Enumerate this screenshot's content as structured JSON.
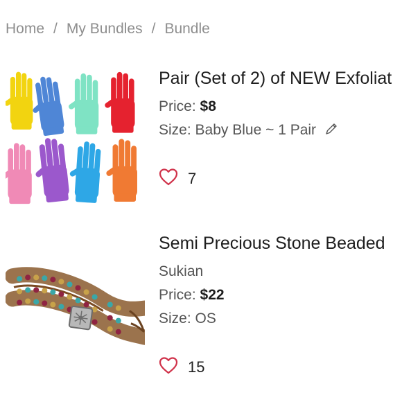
{
  "breadcrumb": {
    "home": "Home",
    "separator": "/",
    "my_bundles": "My Bundles",
    "current": "Bundle"
  },
  "items": [
    {
      "title": "Pair (Set of 2) of NEW Exfoliat",
      "price_label": "Price:",
      "price": "$8",
      "size_label": "Size:",
      "size": "Baby Blue ~ 1 Pair",
      "likes": "7"
    },
    {
      "title": "Semi Precious Stone Beaded",
      "brand": "Sukian",
      "price_label": "Price:",
      "price": "$22",
      "size_label": "Size:",
      "size": "OS",
      "likes": "15"
    }
  ],
  "colors": {
    "accent_heart": "#d0324a",
    "muted_text": "#8e8e8e"
  },
  "icons": {
    "like": "heart-outline-icon",
    "edit": "pencil-icon"
  }
}
